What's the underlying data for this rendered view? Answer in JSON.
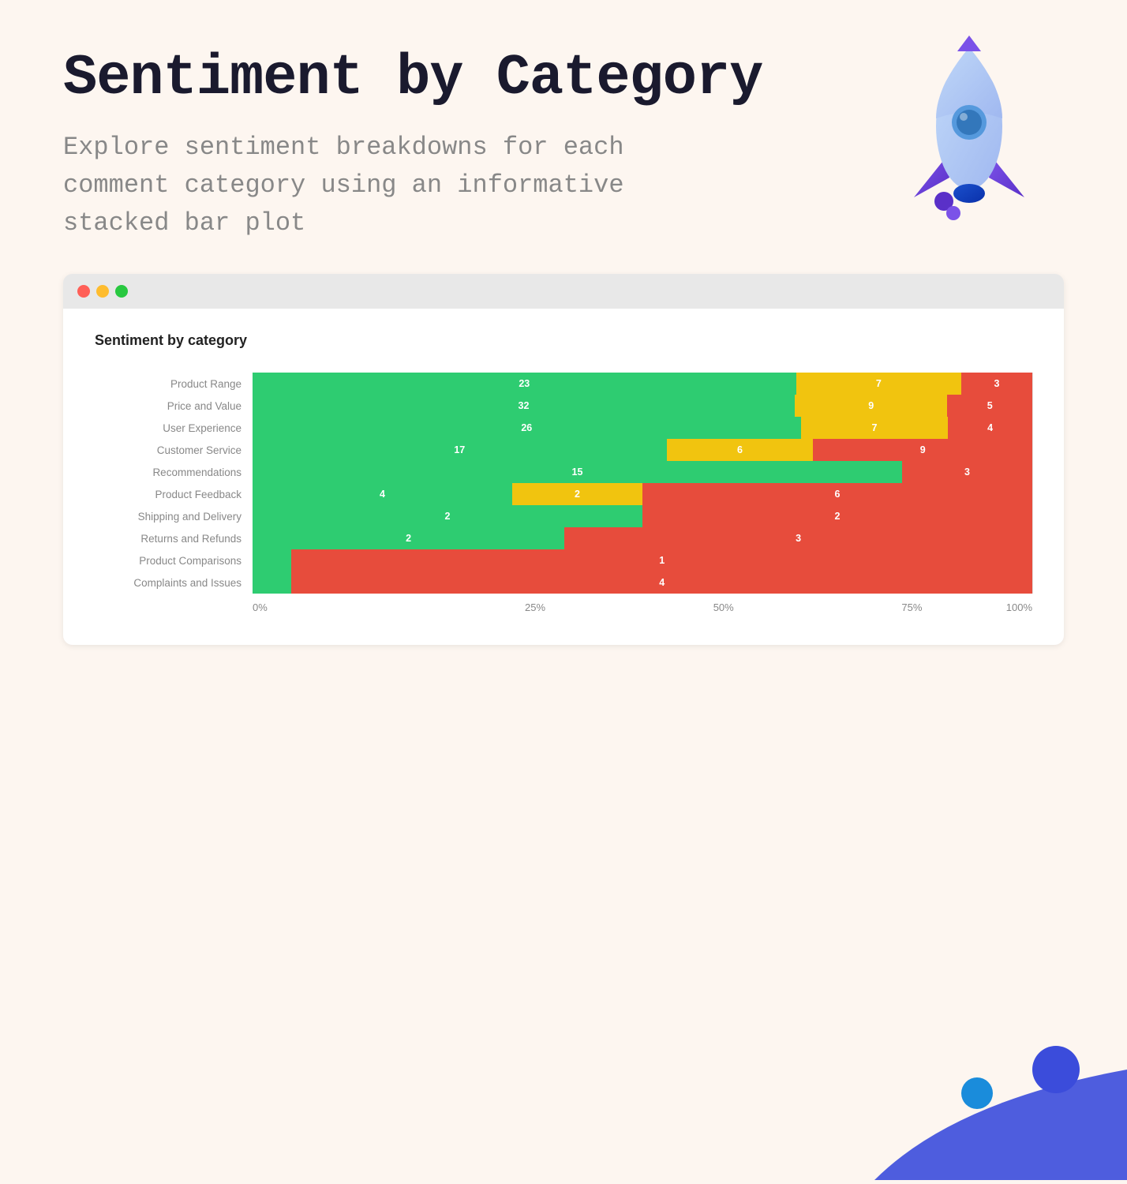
{
  "page": {
    "title": "Sentiment by Category",
    "subtitle": "Explore sentiment breakdowns for each comment category using an informative stacked bar plot",
    "background_color": "#fdf6f0"
  },
  "window": {
    "dots": [
      "red",
      "yellow",
      "green"
    ]
  },
  "chart": {
    "title": "Sentiment by category",
    "categories": [
      {
        "label": "Product Range",
        "green": 23,
        "yellow": 7,
        "red": 3,
        "green_pct": 69.7,
        "yellow_pct": 21.2,
        "red_pct": 9.1
      },
      {
        "label": "Price and Value",
        "green": 32,
        "yellow": 9,
        "red": 5,
        "green_pct": 69.6,
        "yellow_pct": 19.6,
        "red_pct": 10.9
      },
      {
        "label": "User Experience",
        "green": 26,
        "yellow": 7,
        "red": 4,
        "green_pct": 70.3,
        "yellow_pct": 18.9,
        "red_pct": 10.8
      },
      {
        "label": "Customer Service",
        "green": 17,
        "yellow": 6,
        "red": 9,
        "green_pct": 53.1,
        "yellow_pct": 18.8,
        "red_pct": 28.1
      },
      {
        "label": "Recommendations",
        "green": 15,
        "yellow": 0,
        "red": 3,
        "green_pct": 83.3,
        "yellow_pct": 0,
        "red_pct": 16.7
      },
      {
        "label": "Product Feedback",
        "green": 4,
        "yellow": 2,
        "red": 6,
        "green_pct": 33.3,
        "yellow_pct": 16.7,
        "red_pct": 50.0
      },
      {
        "label": "Shipping and Delivery",
        "green": 2,
        "yellow": 0,
        "red": 2,
        "green_pct": 50.0,
        "yellow_pct": 0,
        "red_pct": 50.0
      },
      {
        "label": "Returns and Refunds",
        "green": 2,
        "yellow": 0,
        "red": 3,
        "green_pct": 40.0,
        "yellow_pct": 0,
        "red_pct": 60.0
      },
      {
        "label": "Product Comparisons",
        "green": 0,
        "yellow": 0,
        "red": 1,
        "green_pct": 5.0,
        "yellow_pct": 0,
        "red_pct": 95.0
      },
      {
        "label": "Complaints and Issues",
        "green": 0,
        "yellow": 0,
        "red": 4,
        "green_pct": 5.0,
        "yellow_pct": 0,
        "red_pct": 95.0
      }
    ],
    "x_axis_labels": [
      "0%",
      "25%",
      "50%",
      "75%",
      "100%"
    ]
  }
}
